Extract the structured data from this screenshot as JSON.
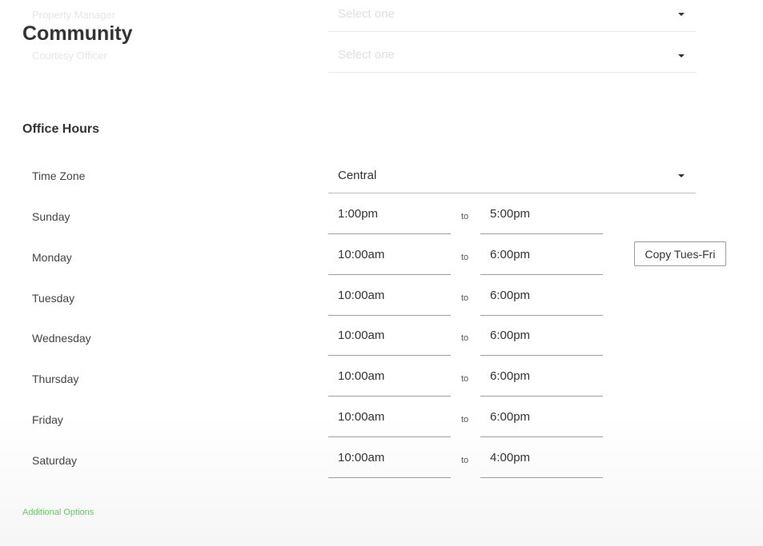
{
  "header": {
    "title": "Community"
  },
  "faded_fields": [
    {
      "label": "Property Manager",
      "placeholder": "Select one"
    },
    {
      "label": "Courtesy Officer",
      "placeholder": "Select one"
    }
  ],
  "office_hours": {
    "title": "Office Hours",
    "time_zone": {
      "label": "Time Zone",
      "value": "Central"
    },
    "to_label": "to",
    "days": [
      {
        "day": "Sunday",
        "open": "1:00pm",
        "close": "5:00pm"
      },
      {
        "day": "Monday",
        "open": "10:00am",
        "close": "6:00pm"
      },
      {
        "day": "Tuesday",
        "open": "10:00am",
        "close": "6:00pm"
      },
      {
        "day": "Wednesday",
        "open": "10:00am",
        "close": "6:00pm"
      },
      {
        "day": "Thursday",
        "open": "10:00am",
        "close": "6:00pm"
      },
      {
        "day": "Friday",
        "open": "10:00am",
        "close": "6:00pm"
      },
      {
        "day": "Saturday",
        "open": "10:00am",
        "close": "4:00pm"
      }
    ],
    "copy_button_label": "Copy Tues-Fri"
  },
  "footer": {
    "additional_options_label": "Additional Options"
  },
  "colors": {
    "link_green": "#6cc26c",
    "text_dark": "#333333",
    "underline": "#9e9e9e"
  },
  "icons": {
    "dropdown": "caret-down-icon"
  }
}
